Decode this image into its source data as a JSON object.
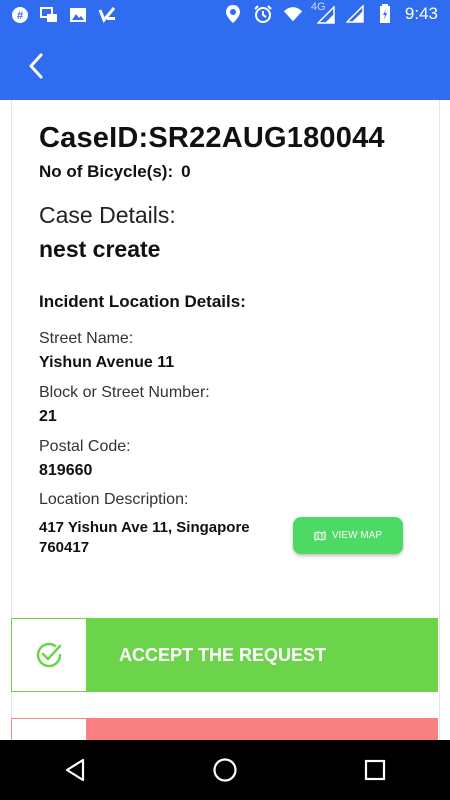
{
  "status_bar": {
    "time": "9:43",
    "network": "4G",
    "left_icons": [
      "hashtag-icon",
      "sync-icon",
      "image-icon",
      "check-list-icon"
    ],
    "right_icons": [
      "location-icon",
      "alarm-icon",
      "wifi-icon",
      "signal-icon",
      "signal-icon",
      "battery-icon"
    ],
    "color": "#2F6CF0"
  },
  "appbar": {
    "back_icon": "chevron-left-icon"
  },
  "case": {
    "case_id": "CaseID:SR22AUG180044",
    "bicycles_label": "No of Bicycle(s):",
    "bicycles_value": "0",
    "details_title": "Case Details:",
    "details_value": "nest create"
  },
  "location": {
    "header": "Incident Location Details:",
    "street_label": "Street Name:",
    "street_value": "Yishun Avenue 11",
    "block_label": "Block or Street Number:",
    "block_value": "21",
    "postal_label": "Postal Code:",
    "postal_value": "819660",
    "description_label": "Location Description:",
    "description_value": "417 Yishun Ave 11, Singapore 760417",
    "view_map_label": "VIEW MAP"
  },
  "actions": {
    "accept_label": "ACCEPT THE REQUEST",
    "accept_color": "#6CD44A",
    "reject_color": "#F88080"
  },
  "navbar": {
    "buttons": [
      "back-triangle-icon",
      "home-circle-icon",
      "recents-square-icon"
    ]
  }
}
